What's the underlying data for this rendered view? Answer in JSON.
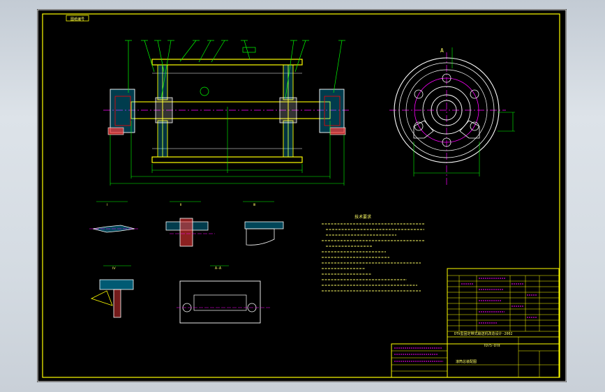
{
  "drawing": {
    "corner_tag": "图纸编号",
    "section_label": "P向",
    "view_top_right_label": "A",
    "notes_title": "技术要求",
    "title_block_name": "DTⅡ型固定带式输送机改造设计-2002",
    "title_block_part": "TD75-DTⅡ",
    "title_block_drawing": "滚筒总装配图",
    "detail_labels": [
      "Ⅰ",
      "Ⅱ",
      "Ⅲ",
      "Ⅳ",
      "A-A"
    ]
  },
  "colors": {
    "background": "#000000",
    "frame": "#ffffff",
    "outline": "#ffff00",
    "part": "#ffffff",
    "dimension": "#00ff00",
    "centerline": "#ff00ff",
    "hatch": "#00c8ff",
    "text": "#ffff66"
  }
}
